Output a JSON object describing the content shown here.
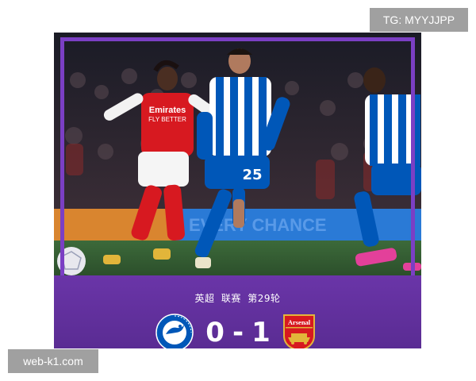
{
  "watermarks": {
    "top_right": "TG: MYYJJPP",
    "bottom_left": "web-k1.com"
  },
  "match": {
    "competition": "英超",
    "round_type": "联赛",
    "round": "第29轮",
    "home_team": "Brighton",
    "away_team": "Arsenal",
    "home_score": "0",
    "separator": "-",
    "away_score": "1"
  },
  "photo": {
    "shirt_sponsor_text": "Emirates",
    "shirt_sponsor_sub": "FLY BETTER",
    "player_number": "25",
    "board_text": "EVERY CHANCE"
  },
  "colors": {
    "score_bar": "#5b2d90",
    "frame_accent": "#7b3fc4",
    "arsenal_red": "#d71920",
    "brighton_blue": "#0057b8"
  },
  "badges": {
    "home_icon": "brighton-crest-icon",
    "away_icon": "arsenal-crest-icon",
    "away_badge_text": "Arsenal"
  }
}
